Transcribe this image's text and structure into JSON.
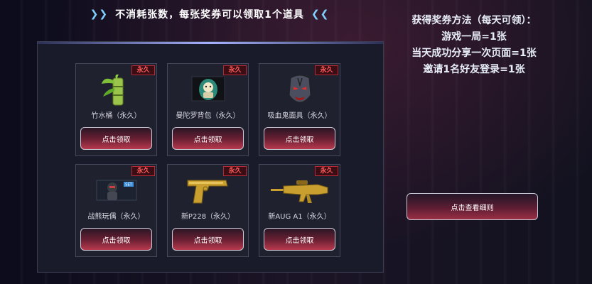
{
  "banner": {
    "left_arrows": "❯❯",
    "text": "不消耗张数，每张奖券可以领取1个道具",
    "right_arrows": "❮❮"
  },
  "items": [
    {
      "name": "竹水桶（永久）",
      "tag": "永久",
      "button": "点击领取",
      "icon": "bamboo-bucket-icon"
    },
    {
      "name": "曼陀罗背包（永久）",
      "tag": "永久",
      "button": "点击领取",
      "icon": "mandala-backpack-icon"
    },
    {
      "name": "吸血鬼面具（永久）",
      "tag": "永久",
      "button": "点击领取",
      "icon": "vampire-mask-icon"
    },
    {
      "name": "战熊玩偶（永久）",
      "tag": "永久",
      "button": "点击领取",
      "icon": "war-bear-doll-icon",
      "badge": "SET"
    },
    {
      "name": "新P228（永久）",
      "tag": "永久",
      "button": "点击领取",
      "icon": "golden-pistol-icon"
    },
    {
      "name": "新AUG A1（永久）",
      "tag": "永久",
      "button": "点击领取",
      "icon": "golden-rifle-icon"
    }
  ],
  "info": {
    "title": "获得奖券方法（每天可领）：",
    "lines": [
      "游戏一局=1张",
      "当天成功分享一次页面=1张",
      "邀请1名好友登录=1张"
    ]
  },
  "details_button": "点击查看细则"
}
